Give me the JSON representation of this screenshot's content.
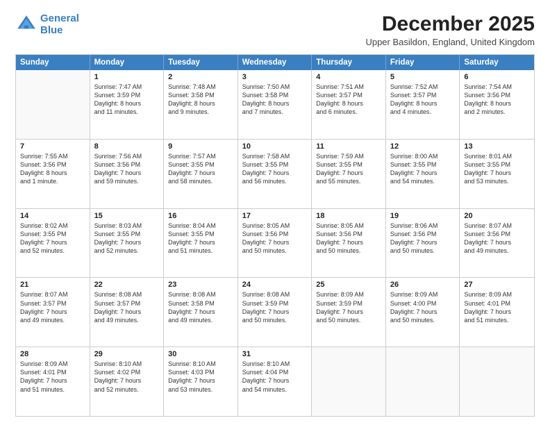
{
  "logo": {
    "line1": "General",
    "line2": "Blue"
  },
  "title": "December 2025",
  "location": "Upper Basildon, England, United Kingdom",
  "header": {
    "days": [
      "Sunday",
      "Monday",
      "Tuesday",
      "Wednesday",
      "Thursday",
      "Friday",
      "Saturday"
    ]
  },
  "weeks": [
    [
      {
        "day": "",
        "lines": []
      },
      {
        "day": "1",
        "lines": [
          "Sunrise: 7:47 AM",
          "Sunset: 3:59 PM",
          "Daylight: 8 hours",
          "and 11 minutes."
        ]
      },
      {
        "day": "2",
        "lines": [
          "Sunrise: 7:48 AM",
          "Sunset: 3:58 PM",
          "Daylight: 8 hours",
          "and 9 minutes."
        ]
      },
      {
        "day": "3",
        "lines": [
          "Sunrise: 7:50 AM",
          "Sunset: 3:58 PM",
          "Daylight: 8 hours",
          "and 7 minutes."
        ]
      },
      {
        "day": "4",
        "lines": [
          "Sunrise: 7:51 AM",
          "Sunset: 3:57 PM",
          "Daylight: 8 hours",
          "and 6 minutes."
        ]
      },
      {
        "day": "5",
        "lines": [
          "Sunrise: 7:52 AM",
          "Sunset: 3:57 PM",
          "Daylight: 8 hours",
          "and 4 minutes."
        ]
      },
      {
        "day": "6",
        "lines": [
          "Sunrise: 7:54 AM",
          "Sunset: 3:56 PM",
          "Daylight: 8 hours",
          "and 2 minutes."
        ]
      }
    ],
    [
      {
        "day": "7",
        "lines": [
          "Sunrise: 7:55 AM",
          "Sunset: 3:56 PM",
          "Daylight: 8 hours",
          "and 1 minute."
        ]
      },
      {
        "day": "8",
        "lines": [
          "Sunrise: 7:56 AM",
          "Sunset: 3:56 PM",
          "Daylight: 7 hours",
          "and 59 minutes."
        ]
      },
      {
        "day": "9",
        "lines": [
          "Sunrise: 7:57 AM",
          "Sunset: 3:55 PM",
          "Daylight: 7 hours",
          "and 58 minutes."
        ]
      },
      {
        "day": "10",
        "lines": [
          "Sunrise: 7:58 AM",
          "Sunset: 3:55 PM",
          "Daylight: 7 hours",
          "and 56 minutes."
        ]
      },
      {
        "day": "11",
        "lines": [
          "Sunrise: 7:59 AM",
          "Sunset: 3:55 PM",
          "Daylight: 7 hours",
          "and 55 minutes."
        ]
      },
      {
        "day": "12",
        "lines": [
          "Sunrise: 8:00 AM",
          "Sunset: 3:55 PM",
          "Daylight: 7 hours",
          "and 54 minutes."
        ]
      },
      {
        "day": "13",
        "lines": [
          "Sunrise: 8:01 AM",
          "Sunset: 3:55 PM",
          "Daylight: 7 hours",
          "and 53 minutes."
        ]
      }
    ],
    [
      {
        "day": "14",
        "lines": [
          "Sunrise: 8:02 AM",
          "Sunset: 3:55 PM",
          "Daylight: 7 hours",
          "and 52 minutes."
        ]
      },
      {
        "day": "15",
        "lines": [
          "Sunrise: 8:03 AM",
          "Sunset: 3:55 PM",
          "Daylight: 7 hours",
          "and 52 minutes."
        ]
      },
      {
        "day": "16",
        "lines": [
          "Sunrise: 8:04 AM",
          "Sunset: 3:55 PM",
          "Daylight: 7 hours",
          "and 51 minutes."
        ]
      },
      {
        "day": "17",
        "lines": [
          "Sunrise: 8:05 AM",
          "Sunset: 3:56 PM",
          "Daylight: 7 hours",
          "and 50 minutes."
        ]
      },
      {
        "day": "18",
        "lines": [
          "Sunrise: 8:05 AM",
          "Sunset: 3:56 PM",
          "Daylight: 7 hours",
          "and 50 minutes."
        ]
      },
      {
        "day": "19",
        "lines": [
          "Sunrise: 8:06 AM",
          "Sunset: 3:56 PM",
          "Daylight: 7 hours",
          "and 50 minutes."
        ]
      },
      {
        "day": "20",
        "lines": [
          "Sunrise: 8:07 AM",
          "Sunset: 3:56 PM",
          "Daylight: 7 hours",
          "and 49 minutes."
        ]
      }
    ],
    [
      {
        "day": "21",
        "lines": [
          "Sunrise: 8:07 AM",
          "Sunset: 3:57 PM",
          "Daylight: 7 hours",
          "and 49 minutes."
        ]
      },
      {
        "day": "22",
        "lines": [
          "Sunrise: 8:08 AM",
          "Sunset: 3:57 PM",
          "Daylight: 7 hours",
          "and 49 minutes."
        ]
      },
      {
        "day": "23",
        "lines": [
          "Sunrise: 8:08 AM",
          "Sunset: 3:58 PM",
          "Daylight: 7 hours",
          "and 49 minutes."
        ]
      },
      {
        "day": "24",
        "lines": [
          "Sunrise: 8:08 AM",
          "Sunset: 3:59 PM",
          "Daylight: 7 hours",
          "and 50 minutes."
        ]
      },
      {
        "day": "25",
        "lines": [
          "Sunrise: 8:09 AM",
          "Sunset: 3:59 PM",
          "Daylight: 7 hours",
          "and 50 minutes."
        ]
      },
      {
        "day": "26",
        "lines": [
          "Sunrise: 8:09 AM",
          "Sunset: 4:00 PM",
          "Daylight: 7 hours",
          "and 50 minutes."
        ]
      },
      {
        "day": "27",
        "lines": [
          "Sunrise: 8:09 AM",
          "Sunset: 4:01 PM",
          "Daylight: 7 hours",
          "and 51 minutes."
        ]
      }
    ],
    [
      {
        "day": "28",
        "lines": [
          "Sunrise: 8:09 AM",
          "Sunset: 4:01 PM",
          "Daylight: 7 hours",
          "and 51 minutes."
        ]
      },
      {
        "day": "29",
        "lines": [
          "Sunrise: 8:10 AM",
          "Sunset: 4:02 PM",
          "Daylight: 7 hours",
          "and 52 minutes."
        ]
      },
      {
        "day": "30",
        "lines": [
          "Sunrise: 8:10 AM",
          "Sunset: 4:03 PM",
          "Daylight: 7 hours",
          "and 53 minutes."
        ]
      },
      {
        "day": "31",
        "lines": [
          "Sunrise: 8:10 AM",
          "Sunset: 4:04 PM",
          "Daylight: 7 hours",
          "and 54 minutes."
        ]
      },
      {
        "day": "",
        "lines": []
      },
      {
        "day": "",
        "lines": []
      },
      {
        "day": "",
        "lines": []
      }
    ]
  ]
}
